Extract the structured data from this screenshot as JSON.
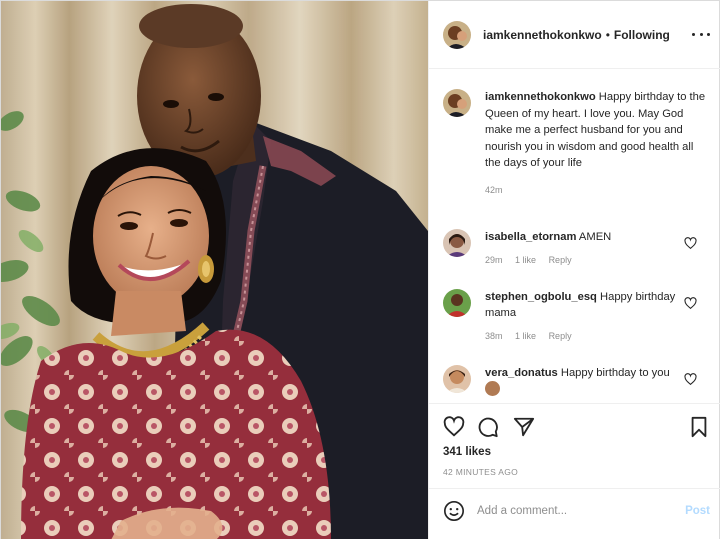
{
  "header": {
    "username": "iamkennethokonkwo",
    "dot": "•",
    "follow_status": "Following"
  },
  "caption": {
    "username": "iamkennethokonkwo",
    "text": "Happy birthday to the Queen of my heart. I love you. May God make me a perfect husband for you and nourish you in wisdom and good health all the days of your life",
    "time": "42m"
  },
  "comments": [
    {
      "username": "isabella_etornam",
      "text": "AMEN",
      "time": "29m",
      "likes": "1 like",
      "reply": "Reply"
    },
    {
      "username": "stephen_ogbolu_esq",
      "text": "Happy birthday mama",
      "time": "38m",
      "likes": "1 like",
      "reply": "Reply"
    },
    {
      "username": "vera_donatus",
      "text": "Happy birthday to you",
      "emoji": "smiling-face-emoji"
    }
  ],
  "post": {
    "likes": "341 likes",
    "time_ago": "42 MINUTES AGO"
  },
  "add_comment": {
    "placeholder": "Add a comment...",
    "post_label": "Post"
  },
  "icons": {
    "like": "heart-icon",
    "comment": "comment-bubble-icon",
    "share": "paper-plane-icon",
    "save": "bookmark-icon",
    "emoji": "smiley-icon",
    "more": "more-options-icon"
  },
  "colors": {
    "text": "#262626",
    "muted": "#8e8e8e",
    "post_button_disabled": "#b3dbff",
    "border": "#efefef"
  }
}
